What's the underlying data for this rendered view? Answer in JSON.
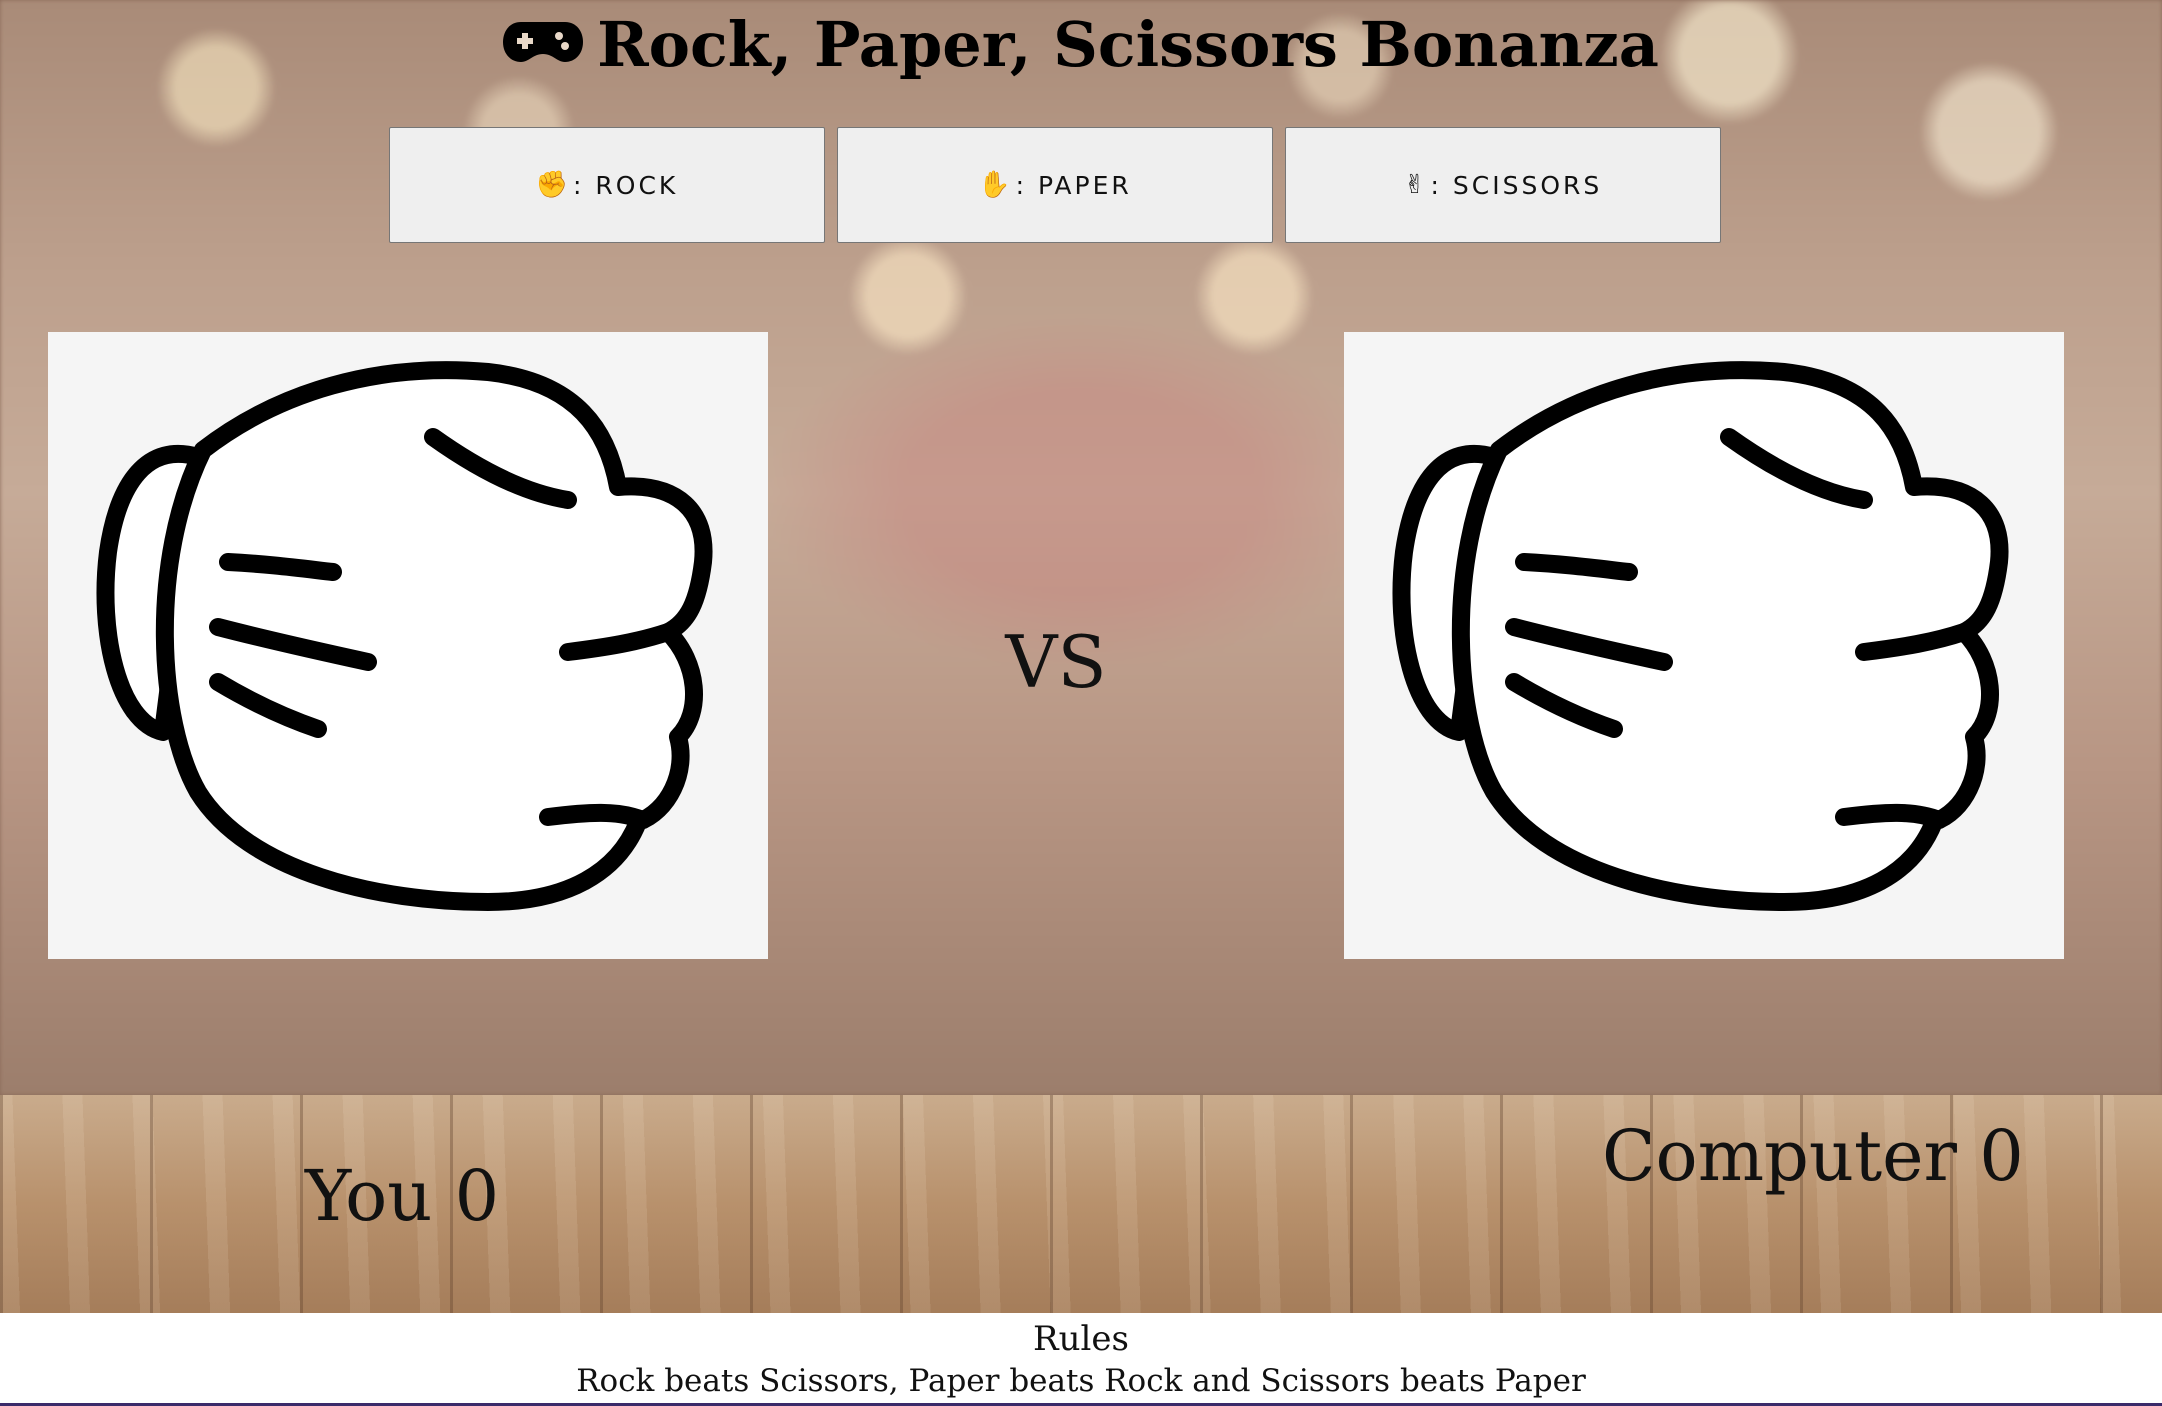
{
  "header": {
    "title": "Rock, Paper, Scissors Bonanza",
    "icon": "gamepad-icon"
  },
  "controls": [
    {
      "label": ": ROCK",
      "icon": "rock-hand-icon"
    },
    {
      "label": ": PAPER",
      "icon": "paper-hand-icon"
    },
    {
      "label": ": SCISSORS",
      "icon": "scissors-hand-icon"
    }
  ],
  "arena": {
    "player_choice": "rock",
    "computer_choice": "rock",
    "vs_label": "VS"
  },
  "scores": {
    "player": "You 0",
    "computer": "Computer 0"
  },
  "footer": {
    "rules_title": "Rules",
    "rules_text": "Rock beats Scissors, Paper beats Rock and Scissors beats Paper"
  }
}
